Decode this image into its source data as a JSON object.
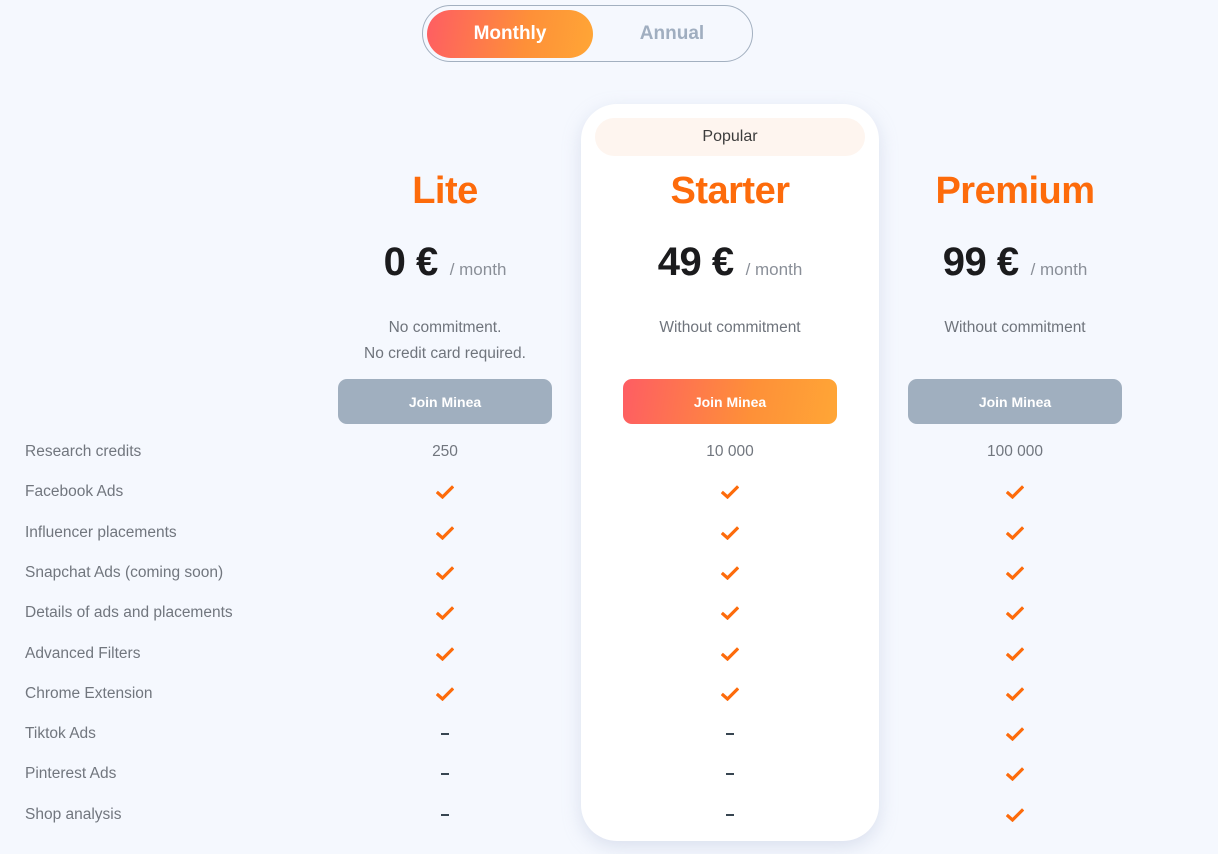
{
  "billing_toggle": {
    "options": [
      {
        "label": "Monthly",
        "active": true
      },
      {
        "label": "Annual",
        "active": false
      }
    ]
  },
  "popular_badge": "Popular",
  "accent_color": "#fd6b0b",
  "plans": [
    {
      "name": "Lite",
      "price": "0 €",
      "period": "/ month",
      "description_lines": [
        "No commitment.",
        "No credit card required."
      ],
      "cta": "Join Minea",
      "highlighted": false
    },
    {
      "name": "Starter",
      "price": "49 €",
      "period": "/ month",
      "description_lines": [
        "Without commitment"
      ],
      "cta": "Join Minea",
      "highlighted": true
    },
    {
      "name": "Premium",
      "price": "99 €",
      "period": "/ month",
      "description_lines": [
        "Without commitment"
      ],
      "cta": "Join Minea",
      "highlighted": false
    }
  ],
  "features": [
    {
      "label": "Research credits",
      "values": [
        "250",
        "10 000",
        "100 000"
      ]
    },
    {
      "label": "Facebook Ads",
      "values": [
        "check",
        "check",
        "check"
      ]
    },
    {
      "label": "Influencer placements",
      "values": [
        "check",
        "check",
        "check"
      ]
    },
    {
      "label": "Snapchat Ads (coming soon)",
      "values": [
        "check",
        "check",
        "check"
      ]
    },
    {
      "label": "Details of ads and placements",
      "values": [
        "check",
        "check",
        "check"
      ]
    },
    {
      "label": "Advanced Filters",
      "values": [
        "check",
        "check",
        "check"
      ]
    },
    {
      "label": "Chrome Extension",
      "values": [
        "check",
        "check",
        "check"
      ]
    },
    {
      "label": "Tiktok Ads",
      "values": [
        "dash",
        "dash",
        "check"
      ]
    },
    {
      "label": "Pinterest Ads",
      "values": [
        "dash",
        "dash",
        "check"
      ]
    },
    {
      "label": "Shop analysis",
      "values": [
        "dash",
        "dash",
        "check"
      ]
    }
  ]
}
